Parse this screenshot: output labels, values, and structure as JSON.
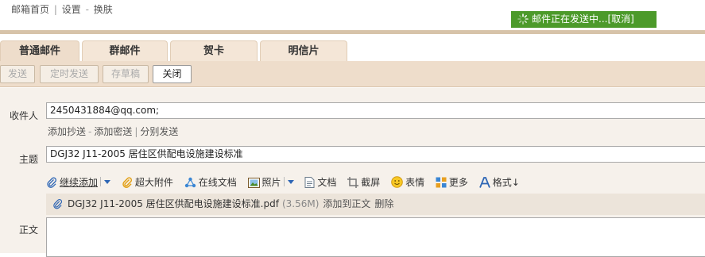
{
  "topnav": {
    "home": "邮箱首页",
    "settings": "设置",
    "skin": "换肤",
    "sep1": "|",
    "sep2": "-"
  },
  "status": {
    "sending_text": "邮件正在发送中...",
    "cancel": "[取消]"
  },
  "tabs": [
    {
      "label": "普通邮件",
      "active": true
    },
    {
      "label": "群邮件",
      "active": false
    },
    {
      "label": "贺卡",
      "active": false
    },
    {
      "label": "明信片",
      "active": false
    }
  ],
  "toolbar": {
    "send": "发送",
    "schedule": "定时发送",
    "draft": "存草稿",
    "close": "关闭"
  },
  "form": {
    "recipient_label": "收件人",
    "recipient_value": "2450431884@qq.com;",
    "add_cc": "添加抄送",
    "add_bcc": "添加密送",
    "separate_send": "分别发送",
    "link_sep1": "-",
    "link_sep2": "|",
    "subject_label": "主题",
    "subject_value": "DGJ32 J11-2005 居住区供配电设施建设标准",
    "body_label": "正文"
  },
  "attach_toolbar": {
    "continue_add": "继续添加",
    "large_attach": "超大附件",
    "online_docs": "在线文档",
    "photos": "照片",
    "document": "文档",
    "screenshot": "截屏",
    "emoji": "表情",
    "more": "更多",
    "format": "格式↓"
  },
  "attachment": {
    "filename": "DGJ32 J11-2005 居住区供配电设施建设标准.pdf",
    "size": "(3.56M)",
    "add_to_body": "添加到正文",
    "delete": "删除"
  },
  "colors": {
    "status_green": "#4c9a2a",
    "toolbar_tan": "#eeddcb",
    "link_blue": "#2e66b5"
  }
}
